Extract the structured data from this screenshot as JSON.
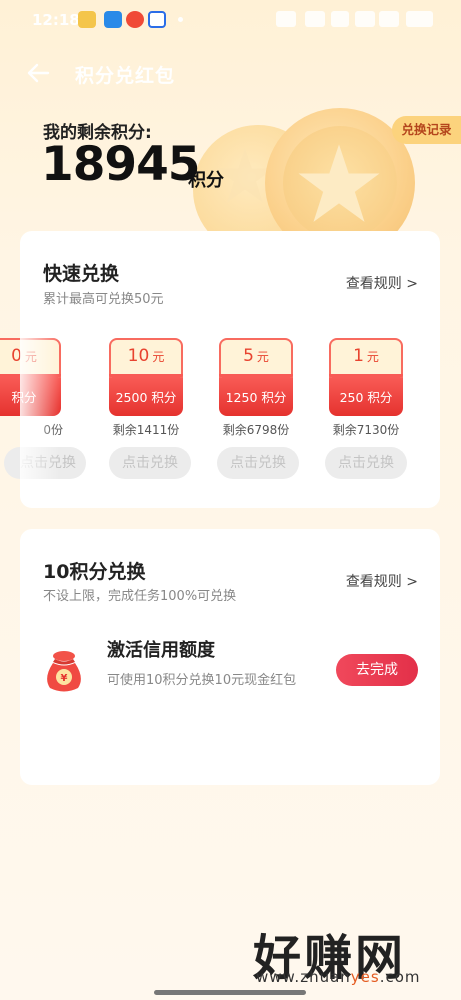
{
  "status_bar": {
    "time": "12:18"
  },
  "header": {
    "title": "积分兑红包"
  },
  "summary": {
    "label": "我的剩余积分:",
    "points": "18945",
    "unit": "积分",
    "history_tag": "兑换记录"
  },
  "quick_exchange": {
    "title": "快速兑换",
    "subtitle": "累计最高可兑换50元",
    "rules_link": "查看规则 >",
    "items": [
      {
        "amount": "0",
        "unit": "元",
        "cost": "积分",
        "remain": "0份",
        "button": "点击兑换"
      },
      {
        "amount": "10",
        "unit": "元",
        "cost": "2500 积分",
        "remain": "剩余1411份",
        "button": "点击兑换"
      },
      {
        "amount": "5",
        "unit": "元",
        "cost": "1250 积分",
        "remain": "剩余6798份",
        "button": "点击兑换"
      },
      {
        "amount": "1",
        "unit": "元",
        "cost": "250 积分",
        "remain": "剩余7130份",
        "button": "点击兑换"
      }
    ]
  },
  "ten_points": {
    "title": "10积分兑换",
    "subtitle": "不设上限，完成任务100%可兑换",
    "rules_link": "查看规则 >",
    "task": {
      "title": "激活信用额度",
      "desc": "可使用10积分兑换10元现金红包",
      "button": "去完成"
    }
  },
  "watermark": {
    "text": "好赚网",
    "domain_prefix": "www.zhuan",
    "domain_highlight": "yes",
    "domain_suffix": ".com"
  },
  "colors": {
    "accent": "#e33049",
    "voucher_red": "#e5322e",
    "tag_bg": "#fcd37d"
  }
}
